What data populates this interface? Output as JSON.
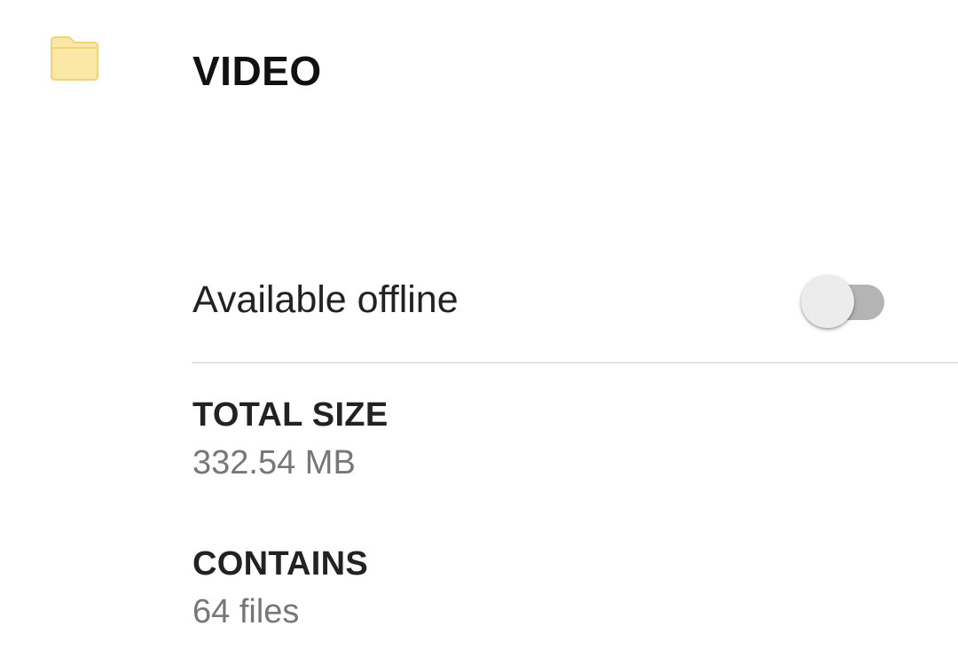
{
  "header": {
    "icon": "folder-icon",
    "icon_color": "#FBE7A6",
    "title": "VIDEO"
  },
  "offline": {
    "label": "Available offline",
    "enabled": false
  },
  "details": {
    "total_size": {
      "heading": "TOTAL SIZE",
      "value": "332.54 MB"
    },
    "contains": {
      "heading": "CONTAINS",
      "value": "64 files"
    }
  }
}
